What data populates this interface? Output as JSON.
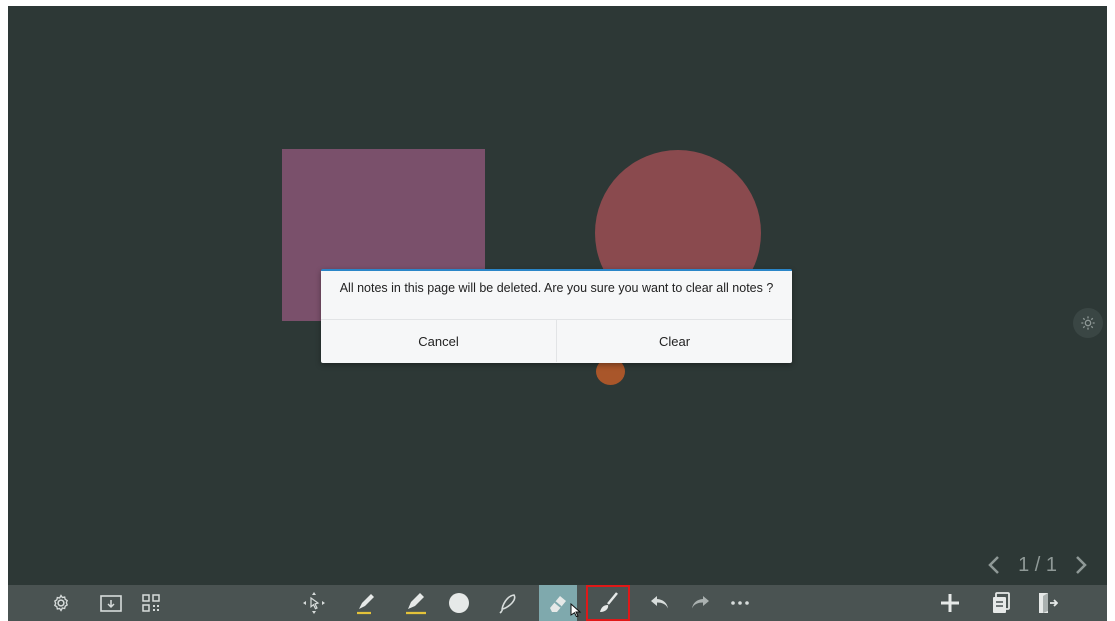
{
  "dialog": {
    "message": "All notes in this page will be deleted. Are you sure you want to clear all notes ?",
    "cancel_label": "Cancel",
    "clear_label": "Clear"
  },
  "pager": {
    "current": "1",
    "separator": "/",
    "total": "1"
  },
  "canvas": {
    "background": "#2d3836",
    "shapes": [
      {
        "kind": "square",
        "color": "#7a506b"
      },
      {
        "kind": "circle",
        "color": "#8a4a4e"
      },
      {
        "kind": "dot",
        "color": "#a9562a"
      }
    ]
  },
  "toolbar": {
    "background": "#4a5352",
    "left_tools": [
      "settings-icon",
      "save-folder-icon",
      "qr-code-icon"
    ],
    "center_tools": [
      "select-move-icon",
      "pen-icon",
      "highlighter-icon",
      "shape-circle-icon",
      "lasso-icon",
      "eraser-icon",
      "clear-brush-icon",
      "undo-icon",
      "redo-icon",
      "more-icon"
    ],
    "right_tools": [
      "add-page-icon",
      "pages-icon",
      "exit-icon"
    ],
    "active_tool": "eraser-icon",
    "selected_tool": "clear-brush-icon",
    "active_color": "#7fa9ad",
    "selected_outline_color": "#e01818"
  }
}
